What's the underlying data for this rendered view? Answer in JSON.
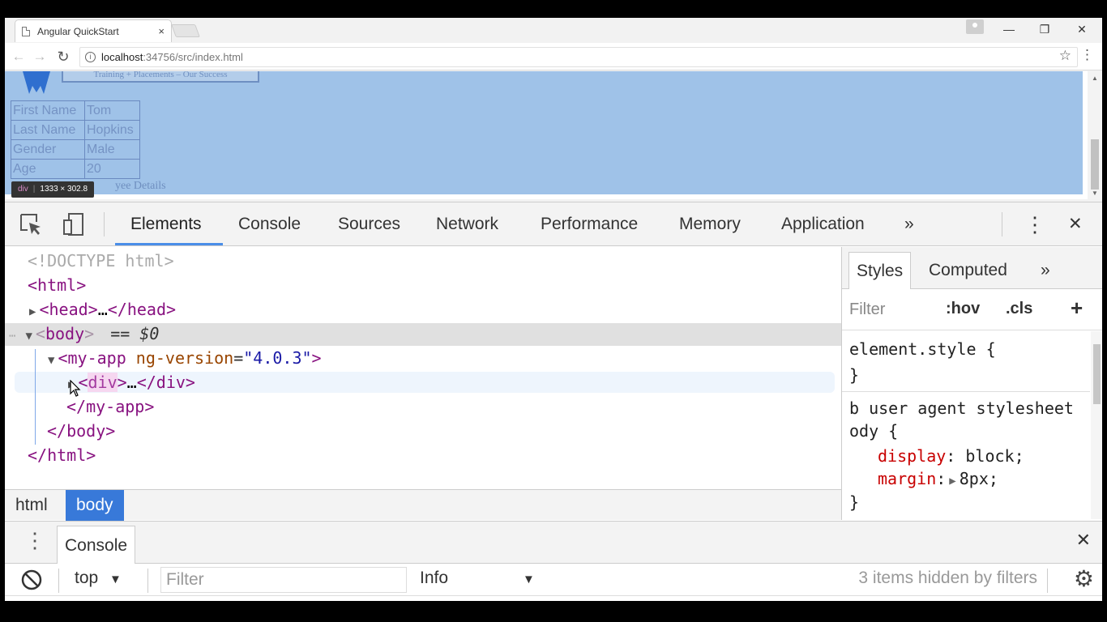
{
  "browser": {
    "tab_title": "Angular QuickStart",
    "tab_close": "×",
    "window_buttons": {
      "minimize": "—",
      "restore": "❐",
      "close": "✕"
    },
    "url_host": "localhost",
    "url_rest": ":34756/src/index.html"
  },
  "page": {
    "banner_text": "Training + Placements – Our Success",
    "employee_table": [
      {
        "key": "First Name",
        "value": "Tom"
      },
      {
        "key": "Last Name",
        "value": "Hopkins"
      },
      {
        "key": "Gender",
        "value": "Male"
      },
      {
        "key": "Age",
        "value": "20"
      }
    ],
    "caption_partial": "yee Details",
    "tooltip_tag": "div",
    "tooltip_size": "1333 × 302.8"
  },
  "devtools": {
    "tabs": [
      "Elements",
      "Console",
      "Sources",
      "Network",
      "Performance",
      "Memory",
      "Application"
    ],
    "more": "»",
    "close": "✕",
    "dom": {
      "doctype": "<!DOCTYPE html>",
      "html_open": "<html>",
      "head": "head",
      "head_ellipsis": "…",
      "body": "body",
      "body_marker": "== $0",
      "myapp_tag": "my-app",
      "myapp_attr": "ng-version",
      "myapp_val": "\"4.0.3\"",
      "div_tag": "div",
      "div_ellipsis": "…",
      "myapp_close": "</my-app>",
      "body_close": "</body>",
      "html_close": "</html>"
    },
    "breadcrumbs": [
      "html",
      "body"
    ],
    "styles": {
      "tabs": [
        "Styles",
        "Computed"
      ],
      "more": "»",
      "filter_placeholder": "Filter",
      "hov": ":hov",
      "cls": ".cls",
      "add": "+",
      "element_style": "element.style {",
      "close_brace": "}",
      "rule_b": "b",
      "ua_label": "user agent stylesheet",
      "selector_rest": "ody {",
      "prop1": "display",
      "val1": "block;",
      "prop2": "margin",
      "val2": "8px;"
    },
    "drawer": {
      "tab": "Console",
      "context": "top",
      "filter_placeholder": "Filter",
      "level": "Info",
      "hidden_msg": "3 items hidden by filters"
    }
  }
}
